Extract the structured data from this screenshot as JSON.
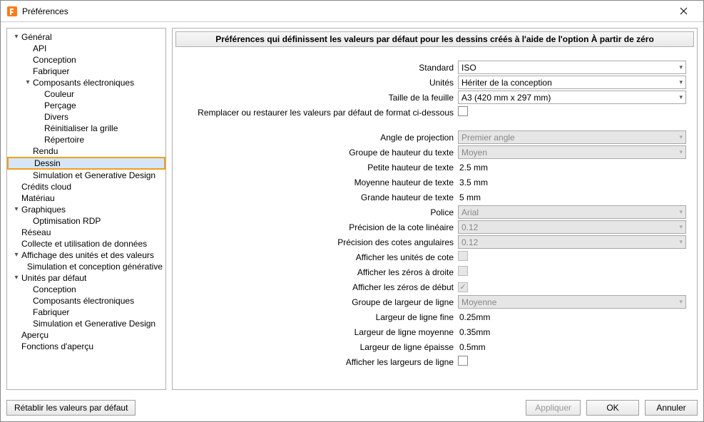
{
  "window": {
    "title": "Préférences"
  },
  "sidebar": {
    "items": [
      {
        "label": "Général",
        "indent": 0,
        "expander": "▾"
      },
      {
        "label": "API",
        "indent": 1,
        "expander": ""
      },
      {
        "label": "Conception",
        "indent": 1,
        "expander": ""
      },
      {
        "label": "Fabriquer",
        "indent": 1,
        "expander": ""
      },
      {
        "label": "Composants électroniques",
        "indent": 1,
        "expander": "▾"
      },
      {
        "label": "Couleur",
        "indent": 2,
        "expander": ""
      },
      {
        "label": "Perçage",
        "indent": 2,
        "expander": ""
      },
      {
        "label": "Divers",
        "indent": 2,
        "expander": ""
      },
      {
        "label": "Réinitialiser la grille",
        "indent": 2,
        "expander": ""
      },
      {
        "label": "Répertoire",
        "indent": 2,
        "expander": ""
      },
      {
        "label": "Rendu",
        "indent": 1,
        "expander": ""
      },
      {
        "label": "Dessin",
        "indent": 1,
        "expander": "",
        "selected": true
      },
      {
        "label": "Simulation et Generative Design",
        "indent": 1,
        "expander": ""
      },
      {
        "label": "Crédits cloud",
        "indent": 0,
        "expander": ""
      },
      {
        "label": "Matériau",
        "indent": 0,
        "expander": ""
      },
      {
        "label": "Graphiques",
        "indent": 0,
        "expander": "▾"
      },
      {
        "label": "Optimisation RDP",
        "indent": 1,
        "expander": ""
      },
      {
        "label": "Réseau",
        "indent": 0,
        "expander": ""
      },
      {
        "label": "Collecte et utilisation de données",
        "indent": 0,
        "expander": ""
      },
      {
        "label": "Affichage des unités et des valeurs",
        "indent": 0,
        "expander": "▾"
      },
      {
        "label": "Simulation et conception générative",
        "indent": 1,
        "expander": ""
      },
      {
        "label": "Unités par défaut",
        "indent": 0,
        "expander": "▾"
      },
      {
        "label": "Conception",
        "indent": 1,
        "expander": ""
      },
      {
        "label": "Composants électroniques",
        "indent": 1,
        "expander": ""
      },
      {
        "label": "Fabriquer",
        "indent": 1,
        "expander": ""
      },
      {
        "label": "Simulation et Generative Design",
        "indent": 1,
        "expander": ""
      },
      {
        "label": "Aperçu",
        "indent": 0,
        "expander": ""
      },
      {
        "label": "Fonctions d'aperçu",
        "indent": 0,
        "expander": ""
      }
    ]
  },
  "panel": {
    "header": "Préférences qui définissent les valeurs par défaut pour les dessins créés à l'aide de l'option À partir de zéro",
    "rows": [
      {
        "label": "Standard",
        "type": "select",
        "value": "ISO",
        "disabled": false
      },
      {
        "label": "Unités",
        "type": "select",
        "value": "Hériter de la conception",
        "disabled": false
      },
      {
        "label": "Taille de la feuille",
        "type": "select",
        "value": "A3 (420 mm x 297 mm)",
        "disabled": false
      },
      {
        "label": "Remplacer ou restaurer les valeurs par défaut de format ci-dessous",
        "type": "checkbox",
        "checked": false,
        "disabled": false
      },
      {
        "label": "",
        "type": "spacer"
      },
      {
        "label": "Angle de projection",
        "type": "select",
        "value": "Premier angle",
        "disabled": true
      },
      {
        "label": "Groupe de hauteur du texte",
        "type": "select",
        "value": "Moyen",
        "disabled": true
      },
      {
        "label": "Petite hauteur de texte",
        "type": "static",
        "value": "2.5 mm"
      },
      {
        "label": "Moyenne hauteur de texte",
        "type": "static",
        "value": "3.5 mm"
      },
      {
        "label": "Grande hauteur de texte",
        "type": "static",
        "value": "5 mm"
      },
      {
        "label": "Police",
        "type": "select",
        "value": "Arial",
        "disabled": true
      },
      {
        "label": "Précision de la cote linéaire",
        "type": "select",
        "value": "0.12",
        "disabled": true
      },
      {
        "label": "Précision des cotes angulaires",
        "type": "select",
        "value": "0.12",
        "disabled": true
      },
      {
        "label": "Afficher les unités de cote",
        "type": "checkbox",
        "checked": false,
        "disabled": true
      },
      {
        "label": "Afficher les zéros à droite",
        "type": "checkbox",
        "checked": false,
        "disabled": true
      },
      {
        "label": "Afficher les zéros de début",
        "type": "checkbox",
        "checked": true,
        "disabled": true
      },
      {
        "label": "Groupe de largeur de ligne",
        "type": "select",
        "value": "Moyenne",
        "disabled": true
      },
      {
        "label": "Largeur de ligne fine",
        "type": "static",
        "value": "0.25mm"
      },
      {
        "label": "Largeur de ligne moyenne",
        "type": "static",
        "value": "0.35mm"
      },
      {
        "label": "Largeur de ligne épaisse",
        "type": "static",
        "value": "0.5mm"
      },
      {
        "label": "Afficher les largeurs de ligne",
        "type": "checkbox",
        "checked": false,
        "disabled": false
      }
    ]
  },
  "footer": {
    "restore": "Rétablir les valeurs par défaut",
    "apply": "Appliquer",
    "ok": "OK",
    "cancel": "Annuler"
  }
}
